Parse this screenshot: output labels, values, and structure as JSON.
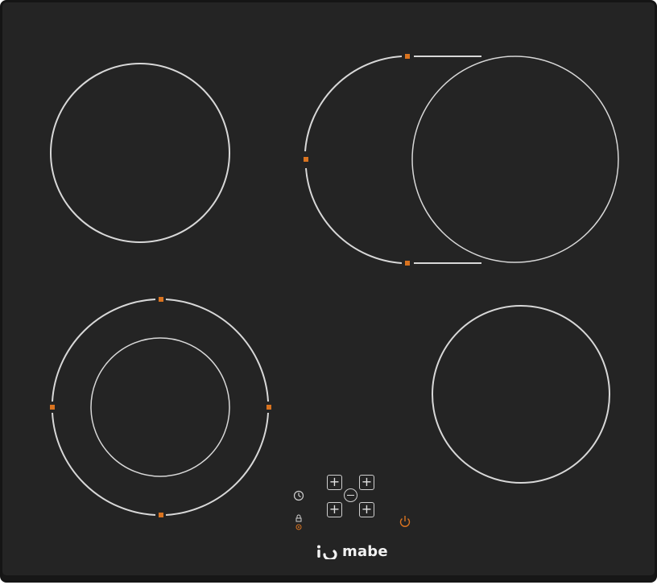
{
  "brand": {
    "name": "mabe",
    "logo_icon": "io-mark-icon"
  },
  "colors": {
    "glass": "#242424",
    "ring": "#d8d8d8",
    "indicator": "#d9731f",
    "key": "#cfcfcf"
  },
  "cooking_zones": [
    {
      "id": "rear-left",
      "type": "single"
    },
    {
      "id": "rear-right",
      "type": "oval-extended"
    },
    {
      "id": "front-left",
      "type": "dual-ring"
    },
    {
      "id": "front-right",
      "type": "single"
    }
  ],
  "controls": {
    "plus_symbol": "+",
    "timer_icon": "clock-icon",
    "lock_icon": "lock-icon",
    "power_icon": "power-icon"
  }
}
